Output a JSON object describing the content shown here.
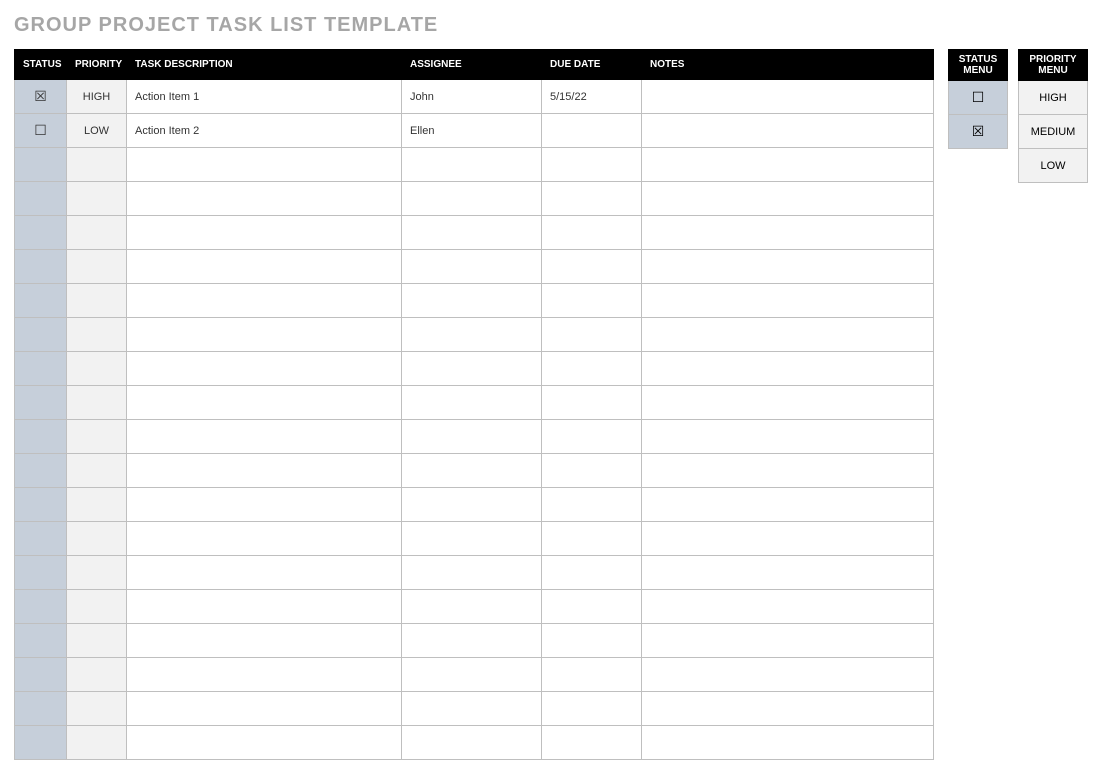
{
  "title": "GROUP PROJECT TASK LIST TEMPLATE",
  "columns": {
    "status": "STATUS",
    "priority": "PRIORITY",
    "task_description": "TASK DESCRIPTION",
    "assignee": "ASSIGNEE",
    "due_date": "DUE DATE",
    "notes": "NOTES"
  },
  "rows": [
    {
      "status": "checked",
      "priority": "HIGH",
      "task_description": "Action Item 1",
      "assignee": "John",
      "due_date": "5/15/22",
      "notes": ""
    },
    {
      "status": "unchecked",
      "priority": "LOW",
      "task_description": "Action Item 2",
      "assignee": "Ellen",
      "due_date": "",
      "notes": ""
    },
    {
      "status": "",
      "priority": "",
      "task_description": "",
      "assignee": "",
      "due_date": "",
      "notes": ""
    },
    {
      "status": "",
      "priority": "",
      "task_description": "",
      "assignee": "",
      "due_date": "",
      "notes": ""
    },
    {
      "status": "",
      "priority": "",
      "task_description": "",
      "assignee": "",
      "due_date": "",
      "notes": ""
    },
    {
      "status": "",
      "priority": "",
      "task_description": "",
      "assignee": "",
      "due_date": "",
      "notes": ""
    },
    {
      "status": "",
      "priority": "",
      "task_description": "",
      "assignee": "",
      "due_date": "",
      "notes": ""
    },
    {
      "status": "",
      "priority": "",
      "task_description": "",
      "assignee": "",
      "due_date": "",
      "notes": ""
    },
    {
      "status": "",
      "priority": "",
      "task_description": "",
      "assignee": "",
      "due_date": "",
      "notes": ""
    },
    {
      "status": "",
      "priority": "",
      "task_description": "",
      "assignee": "",
      "due_date": "",
      "notes": ""
    },
    {
      "status": "",
      "priority": "",
      "task_description": "",
      "assignee": "",
      "due_date": "",
      "notes": ""
    },
    {
      "status": "",
      "priority": "",
      "task_description": "",
      "assignee": "",
      "due_date": "",
      "notes": ""
    },
    {
      "status": "",
      "priority": "",
      "task_description": "",
      "assignee": "",
      "due_date": "",
      "notes": ""
    },
    {
      "status": "",
      "priority": "",
      "task_description": "",
      "assignee": "",
      "due_date": "",
      "notes": ""
    },
    {
      "status": "",
      "priority": "",
      "task_description": "",
      "assignee": "",
      "due_date": "",
      "notes": ""
    },
    {
      "status": "",
      "priority": "",
      "task_description": "",
      "assignee": "",
      "due_date": "",
      "notes": ""
    },
    {
      "status": "",
      "priority": "",
      "task_description": "",
      "assignee": "",
      "due_date": "",
      "notes": ""
    },
    {
      "status": "",
      "priority": "",
      "task_description": "",
      "assignee": "",
      "due_date": "",
      "notes": ""
    },
    {
      "status": "",
      "priority": "",
      "task_description": "",
      "assignee": "",
      "due_date": "",
      "notes": ""
    },
    {
      "status": "",
      "priority": "",
      "task_description": "",
      "assignee": "",
      "due_date": "",
      "notes": ""
    }
  ],
  "status_menu": {
    "header": "STATUS MENU",
    "items": [
      "unchecked",
      "checked"
    ]
  },
  "priority_menu": {
    "header": "PRIORITY MENU",
    "items": [
      "HIGH",
      "MEDIUM",
      "LOW"
    ]
  },
  "glyphs": {
    "checked": "☒",
    "unchecked": "☐",
    "": ""
  }
}
